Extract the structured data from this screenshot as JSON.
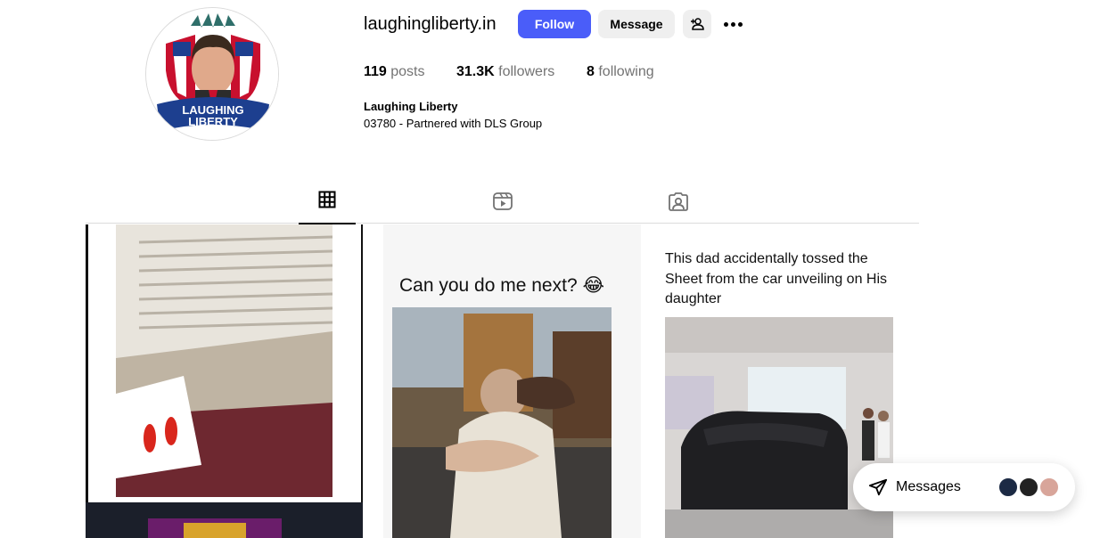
{
  "profile": {
    "username": "laughingliberty.in",
    "display_name": "Laughing Liberty",
    "bio": "03780 - Partnered with DLS Group",
    "logo_text_line1": "LAUGHING",
    "logo_text_line2": "LIBERTY"
  },
  "actions": {
    "follow_label": "Follow",
    "message_label": "Message"
  },
  "stats": {
    "posts_count": "119",
    "posts_label": " posts",
    "followers_count": "31.3K",
    "followers_label": " followers",
    "following_count": "8",
    "following_label": " following"
  },
  "tabs": [
    "posts-grid-icon",
    "reels-icon",
    "tagged-icon"
  ],
  "posts": [
    {
      "caption": ""
    },
    {
      "caption": "Can you do me next? 😂"
    },
    {
      "caption": "This dad accidentally tossed the Sheet from the car unveiling on His daughter"
    }
  ],
  "messages_widget": {
    "label": "Messages"
  },
  "colors": {
    "follow_button": "#4a5df9",
    "secondary_button": "#efefef"
  }
}
